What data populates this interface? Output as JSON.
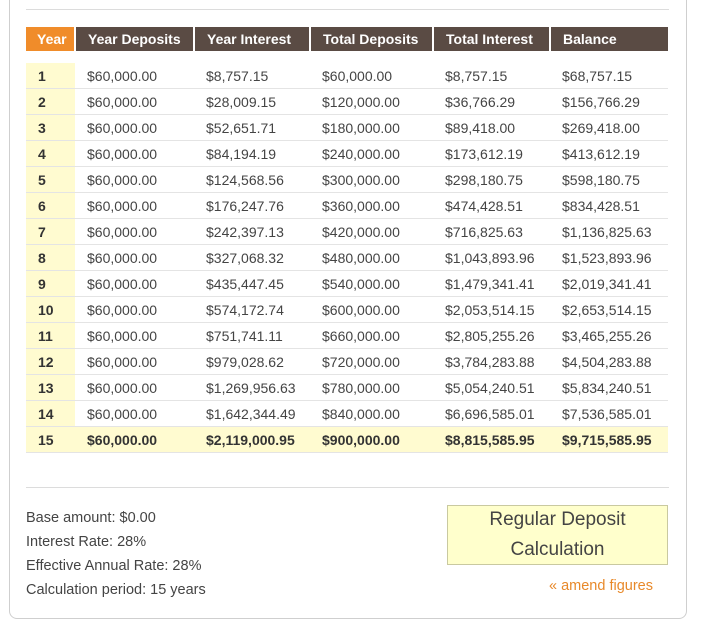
{
  "table": {
    "headers": [
      "Year",
      "Year Deposits",
      "Year Interest",
      "Total Deposits",
      "Total Interest",
      "Balance"
    ],
    "rows": [
      [
        "1",
        "$60,000.00",
        "$8,757.15",
        "$60,000.00",
        "$8,757.15",
        "$68,757.15"
      ],
      [
        "2",
        "$60,000.00",
        "$28,009.15",
        "$120,000.00",
        "$36,766.29",
        "$156,766.29"
      ],
      [
        "3",
        "$60,000.00",
        "$52,651.71",
        "$180,000.00",
        "$89,418.00",
        "$269,418.00"
      ],
      [
        "4",
        "$60,000.00",
        "$84,194.19",
        "$240,000.00",
        "$173,612.19",
        "$413,612.19"
      ],
      [
        "5",
        "$60,000.00",
        "$124,568.56",
        "$300,000.00",
        "$298,180.75",
        "$598,180.75"
      ],
      [
        "6",
        "$60,000.00",
        "$176,247.76",
        "$360,000.00",
        "$474,428.51",
        "$834,428.51"
      ],
      [
        "7",
        "$60,000.00",
        "$242,397.13",
        "$420,000.00",
        "$716,825.63",
        "$1,136,825.63"
      ],
      [
        "8",
        "$60,000.00",
        "$327,068.32",
        "$480,000.00",
        "$1,043,893.96",
        "$1,523,893.96"
      ],
      [
        "9",
        "$60,000.00",
        "$435,447.45",
        "$540,000.00",
        "$1,479,341.41",
        "$2,019,341.41"
      ],
      [
        "10",
        "$60,000.00",
        "$574,172.74",
        "$600,000.00",
        "$2,053,514.15",
        "$2,653,514.15"
      ],
      [
        "11",
        "$60,000.00",
        "$751,741.11",
        "$660,000.00",
        "$2,805,255.26",
        "$3,465,255.26"
      ],
      [
        "12",
        "$60,000.00",
        "$979,028.62",
        "$720,000.00",
        "$3,784,283.88",
        "$4,504,283.88"
      ],
      [
        "13",
        "$60,000.00",
        "$1,269,956.63",
        "$780,000.00",
        "$5,054,240.51",
        "$5,834,240.51"
      ],
      [
        "14",
        "$60,000.00",
        "$1,642,344.49",
        "$840,000.00",
        "$6,696,585.01",
        "$7,536,585.01"
      ],
      [
        "15",
        "$60,000.00",
        "$2,119,000.95",
        "$900,000.00",
        "$8,815,585.95",
        "$9,715,585.95"
      ]
    ]
  },
  "summary": {
    "base_amount": "Base amount: $0.00",
    "interest_rate": "Interest Rate: 28%",
    "effective_rate": "Effective Annual Rate: 28%",
    "period": "Calculation period: 15 years"
  },
  "calc_type": {
    "line1": "Regular Deposit",
    "line2": "Calculation"
  },
  "amend_link": "« amend figures",
  "colors": {
    "header_bg": "#5a4b44",
    "year_header_bg": "#f08c2a",
    "highlight_bg": "#fffbd0",
    "link": "#e8892a"
  }
}
